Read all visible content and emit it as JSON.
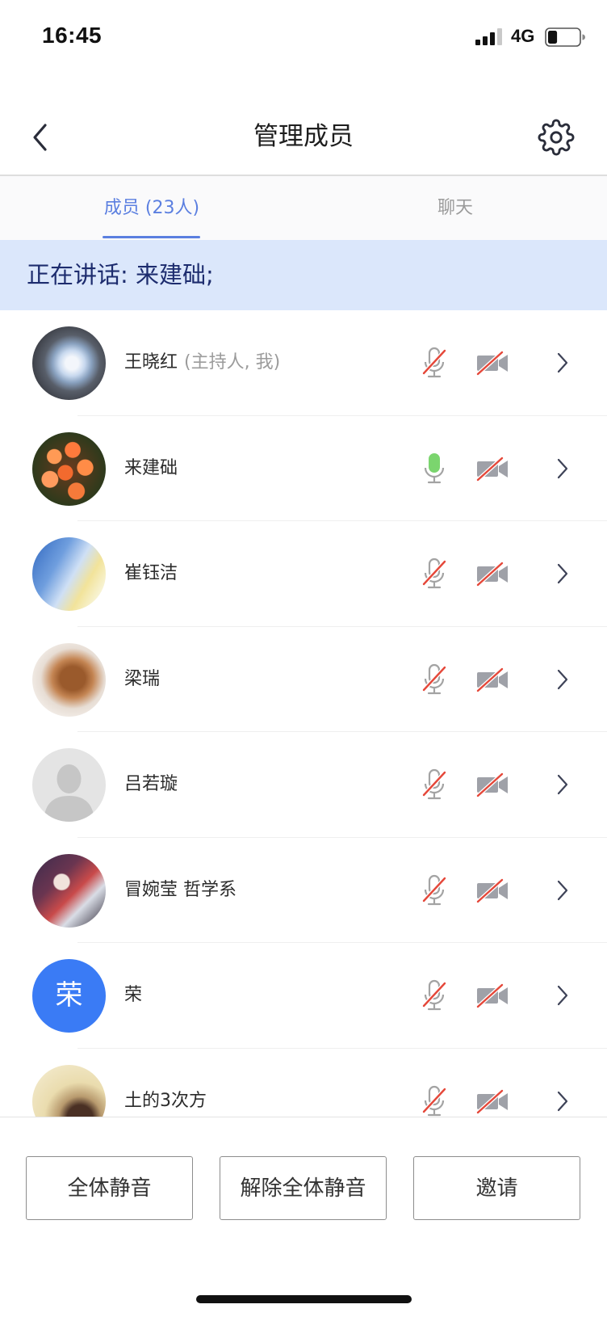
{
  "status_bar": {
    "time": "16:45",
    "network": "4G",
    "signal_bars": 3,
    "signal_max": 4,
    "battery_level": 0.3
  },
  "nav": {
    "title": "管理成员",
    "back_icon": "chevron-left-icon",
    "settings_icon": "gear-icon"
  },
  "tabs": [
    {
      "label": "成员 (23人)",
      "active": true
    },
    {
      "label": "聊天",
      "active": false
    }
  ],
  "speaking_banner": {
    "text": "正在讲话: 来建础;"
  },
  "members": [
    {
      "name": "王晓红",
      "note": "(主持人, 我)",
      "mic_icon": "mic-muted-icon",
      "camera_icon": "camera-off-icon"
    },
    {
      "name": "来建础",
      "note": "",
      "mic_icon": "mic-on-icon",
      "camera_icon": "camera-off-icon"
    },
    {
      "name": "崔钰洁",
      "note": "",
      "mic_icon": "mic-muted-icon",
      "camera_icon": "camera-off-icon"
    },
    {
      "name": "梁瑞",
      "note": "",
      "mic_icon": "mic-muted-icon",
      "camera_icon": "camera-off-icon"
    },
    {
      "name": "吕若璇",
      "note": "",
      "mic_icon": "mic-muted-icon",
      "camera_icon": "camera-off-icon"
    },
    {
      "name": "冒婉莹 哲学系",
      "note": "",
      "mic_icon": "mic-muted-icon",
      "camera_icon": "camera-off-icon"
    },
    {
      "name": "荣",
      "note": "",
      "avatar_text": "荣",
      "mic_icon": "mic-muted-icon",
      "camera_icon": "camera-off-icon"
    },
    {
      "name": "土的3次方",
      "note": "",
      "mic_icon": "mic-muted-icon",
      "camera_icon": "camera-off-icon"
    }
  ],
  "actions": {
    "mute_all": "全体静音",
    "unmute_all": "解除全体静音",
    "invite": "邀请"
  },
  "colors": {
    "accent": "#5b7fe0",
    "banner_bg": "#dbe7fb",
    "speaking_green": "#7bd56e",
    "muted_red": "#e5483a",
    "icon_gray": "#a3a3a3",
    "avatar_blue": "#3a7bf5"
  }
}
